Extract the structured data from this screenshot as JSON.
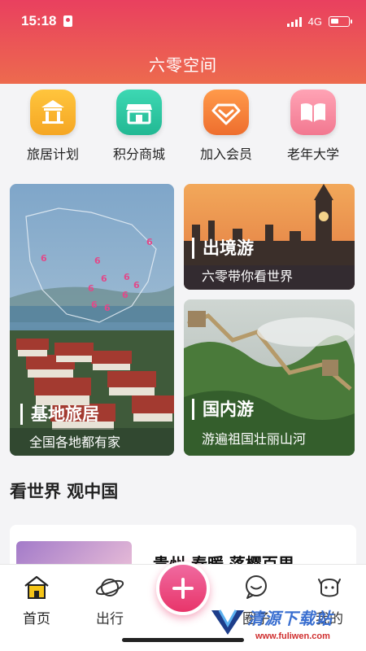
{
  "status_bar": {
    "time": "15:18",
    "network": "4G"
  },
  "header": {
    "title": "六零空间"
  },
  "quick_menu": [
    {
      "label": "旅居计划",
      "icon": "pavilion-icon",
      "color": "#f5a623"
    },
    {
      "label": "积分商城",
      "icon": "store-icon",
      "color": "#2ec4a3"
    },
    {
      "label": "加入会员",
      "icon": "diamond-icon",
      "color": "#f07a3a"
    },
    {
      "label": "老年大学",
      "icon": "book-icon",
      "color": "#f2859c"
    }
  ],
  "cards": {
    "base": {
      "title": "基地旅居",
      "subtitle": "全国各地都有家"
    },
    "abroad": {
      "title": "出境游",
      "subtitle": "六零带你看世界"
    },
    "domestic": {
      "title": "国内游",
      "subtitle": "游遍祖国壮丽山河"
    }
  },
  "map_markers": [
    "6",
    "6",
    "6",
    "6",
    "6",
    "6",
    "6",
    "6",
    "6",
    "6"
  ],
  "section": {
    "title": "看世界 观中国"
  },
  "news": {
    "title": "贵州 春暖 落樱百里"
  },
  "tabbar": [
    {
      "label": "首页",
      "icon": "home-icon"
    },
    {
      "label": "出行",
      "icon": "planet-icon"
    },
    {
      "label": "",
      "icon": "plus-icon"
    },
    {
      "label": "圈子",
      "icon": "chat-bubble-icon"
    },
    {
      "label": "我的",
      "icon": "face-icon"
    }
  ],
  "watermark": {
    "text": "清源下载站",
    "url": "www.fuliwen.com"
  },
  "colors": {
    "header_start": "#e9405f",
    "header_end": "#ed6a4e",
    "accent": "#e8356a"
  }
}
